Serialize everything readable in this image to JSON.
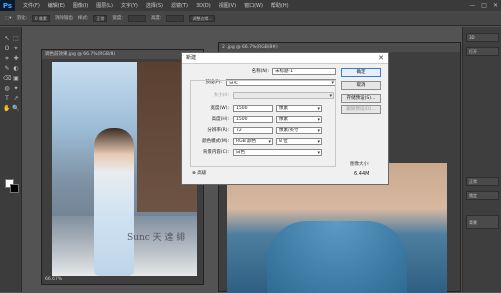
{
  "app": {
    "logo": "Ps"
  },
  "menu": [
    "文件(F)",
    "编辑(E)",
    "图像(I)",
    "图层(L)",
    "文字(Y)",
    "选择(S)",
    "滤镜(T)",
    "3D(D)",
    "视图(V)",
    "窗口(W)",
    "帮助(H)"
  ],
  "window_controls": [
    "—",
    "□",
    "✕"
  ],
  "options_bar": {
    "feather_label": "羽化:",
    "feather_value": "0 像素",
    "antialias": "消除锯齿",
    "style_label": "样式:",
    "style_value": "正常",
    "width_label": "宽度:",
    "height_label": "高度:",
    "refine": "调整边缘..."
  },
  "doc1": {
    "title": "调色前效果.jpg @ 66.7%(RGB/8)",
    "zoom": "66.67%",
    "watermark": "Sunc 天 達 緋"
  },
  "doc2": {
    "title": "2 .jpg @ 66.7%(RGB/8#)"
  },
  "right_panel": {
    "tab1": "3D",
    "tab2": "打开",
    "tab3": "正常",
    "tab4": "锁定",
    "tab5": "背景"
  },
  "dialog": {
    "title": "新建",
    "close": "✕",
    "name_label": "名称(N):",
    "name_value": "未标题-1",
    "preset_label": "预设(P):",
    "preset_value": "自定",
    "size_label": "大小(I):",
    "width_label": "宽度(W):",
    "width_value": "1500",
    "width_unit": "像素",
    "height_label": "高度(H):",
    "height_value": "1500",
    "height_unit": "像素",
    "res_label": "分辨率(R):",
    "res_value": "72",
    "res_unit": "像素/英寸",
    "mode_label": "颜色模式(M):",
    "mode_value": "RGB 颜色",
    "bits_value": "8 位",
    "bg_label": "背景内容(C):",
    "bg_value": "白色",
    "advanced_label": "高级",
    "ok": "确定",
    "cancel": "取消",
    "save_preset": "存储预设(S)...",
    "delete_preset": "删除预设(D)...",
    "image_size_label": "图像大小:",
    "image_size_value": "6.44M"
  },
  "tools": [
    "↖",
    "⬚",
    "ʘ",
    "⌖",
    "⌗",
    "✚",
    "✎",
    "◐",
    "⌫",
    "▣",
    "◍",
    "✦",
    "T",
    "↗",
    "✋",
    "🔍"
  ]
}
